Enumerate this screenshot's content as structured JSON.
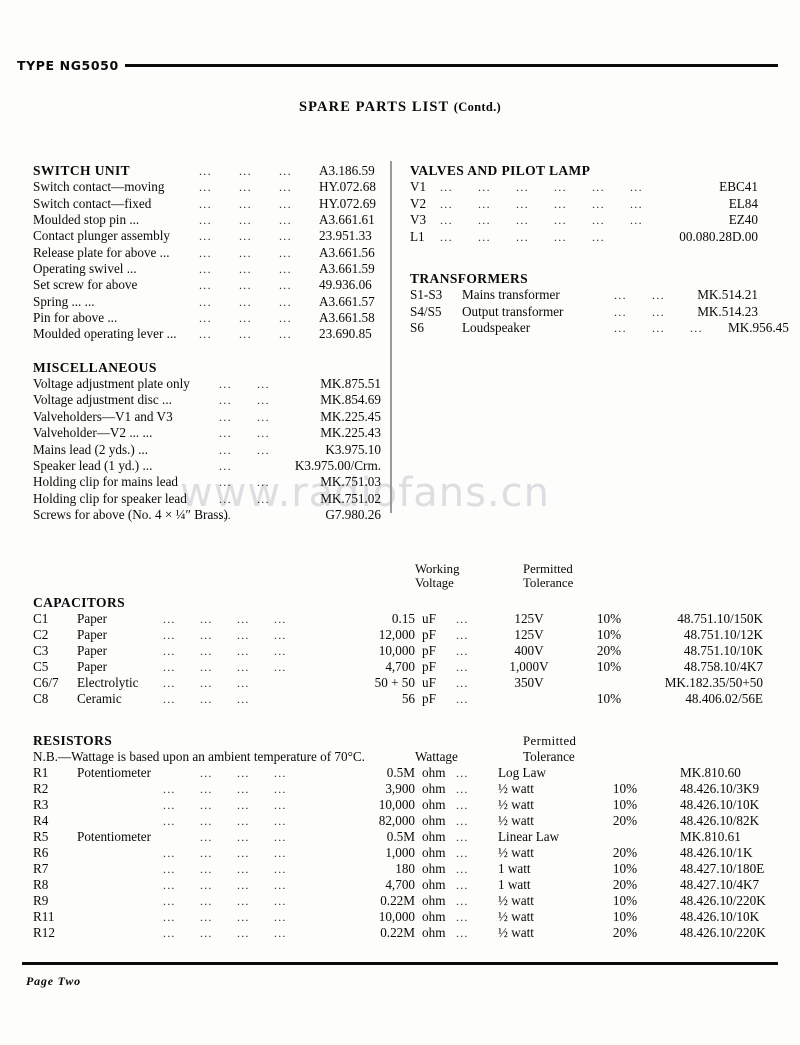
{
  "header": {
    "type_label": "TYPE  NG5050",
    "title": "SPARE PARTS LIST",
    "title_contd": "(Contd.)"
  },
  "watermark": "www.radiofans.cn",
  "footer": {
    "page_label": "Page Two"
  },
  "switch_unit": {
    "heading": "SWITCH UNIT",
    "heading_code": "A3.186.59",
    "rows": [
      {
        "label": "Switch contact—moving",
        "code": "HY.072.68"
      },
      {
        "label": "Switch contact—fixed",
        "code": "HY.072.69"
      },
      {
        "label": "Moulded stop pin ...",
        "code": "A3.661.61"
      },
      {
        "label": "Contact plunger assembly",
        "code": "23.951.33"
      },
      {
        "label": "Release plate for above ...",
        "code": "A3.661.56"
      },
      {
        "label": "Operating swivel   ...",
        "code": "A3.661.59"
      },
      {
        "label": "Set screw for above",
        "code": "49.936.06"
      },
      {
        "label": "Spring        ...        ...",
        "code": "A3.661.57"
      },
      {
        "label": "Pin for above      ...",
        "code": "A3.661.58"
      },
      {
        "label": "Moulded operating lever ...",
        "code": "23.690.85"
      }
    ]
  },
  "miscellaneous": {
    "heading": "MISCELLANEOUS",
    "rows": [
      {
        "label": "Voltage adjustment plate only",
        "dots": 2,
        "code": "MK.875.51"
      },
      {
        "label": "Voltage adjustment disc  ...",
        "dots": 2,
        "code": "MK.854.69"
      },
      {
        "label": "Valveholders—V1 and V3",
        "dots": 2,
        "code": "MK.225.45"
      },
      {
        "label": "Valveholder—V2   ...        ...",
        "dots": 2,
        "code": "MK.225.43"
      },
      {
        "label": "Mains lead (2 yds.)        ...",
        "dots": 2,
        "code": "K3.975.10"
      },
      {
        "label": "Speaker lead (1 yd.)     ...",
        "dots": 1,
        "code": "K3.975.00/Crm."
      },
      {
        "label": "Holding clip for mains lead",
        "dots": 2,
        "code": "MK.751.03"
      },
      {
        "label": "Holding clip for speaker lead",
        "dots": 2,
        "code": "MK.751.02"
      },
      {
        "label": "Screws for above (No. 4 × ¼″ Brass)",
        "dots": 1,
        "code": "G7.980.26"
      }
    ]
  },
  "valves": {
    "heading": "VALVES AND PILOT LAMP",
    "rows": [
      {
        "id": "V1",
        "dots": 6,
        "code": "EBC41"
      },
      {
        "id": "V2",
        "dots": 6,
        "code": "EL84"
      },
      {
        "id": "V3",
        "dots": 6,
        "code": "EZ40"
      },
      {
        "id": "L1",
        "dots": 5,
        "code": "00.080.28D.00"
      }
    ]
  },
  "transformers": {
    "heading": "TRANSFORMERS",
    "rows": [
      {
        "id": "S1-S3",
        "name": "Mains transformer",
        "dots": 2,
        "code": "MK.514.21"
      },
      {
        "id": "S4/S5",
        "name": "Output transformer",
        "dots": 2,
        "code": "MK.514.23"
      },
      {
        "id": "S6",
        "name": "Loudspeaker",
        "dots": 3,
        "code": "MK.956.45"
      }
    ]
  },
  "capacitors": {
    "heading": "CAPACITORS",
    "columns": {
      "working_voltage": [
        "Working",
        "Voltage"
      ],
      "permitted_tolerance": [
        "Permitted",
        "Tolerance"
      ]
    },
    "rows": [
      {
        "ref": "C1",
        "type": "Paper",
        "dots": 4,
        "value": "0.15",
        "unit": "uF",
        "voltage": "125V",
        "tolerance": "10%",
        "code": "48.751.10/150K"
      },
      {
        "ref": "C2",
        "type": "Paper",
        "dots": 4,
        "value": "12,000",
        "unit": "pF",
        "voltage": "125V",
        "tolerance": "10%",
        "code": "48.751.10/12K"
      },
      {
        "ref": "C3",
        "type": "Paper",
        "dots": 4,
        "value": "10,000",
        "unit": "pF",
        "voltage": "400V",
        "tolerance": "20%",
        "code": "48.751.10/10K"
      },
      {
        "ref": "C5",
        "type": "Paper",
        "dots": 4,
        "value": "4,700",
        "unit": "pF",
        "voltage": "1,000V",
        "tolerance": "10%",
        "code": "48.758.10/4K7"
      },
      {
        "ref": "C6/7",
        "type": "Electrolytic",
        "dots": 3,
        "value": "50 + 50",
        "unit": "uF",
        "voltage": "350V",
        "tolerance": "",
        "code": "MK.182.35/50+50"
      },
      {
        "ref": "C8",
        "type": "Ceramic",
        "dots": 3,
        "value": "56",
        "unit": "pF",
        "voltage": "",
        "tolerance": "10%",
        "code": "48.406.02/56E"
      }
    ]
  },
  "resistors": {
    "heading": "RESISTORS",
    "note": "N.B.—Wattage is based upon an ambient temperature of 70°C.",
    "columns": {
      "wattage": "Wattage",
      "permitted_tolerance": [
        "Permitted",
        "Tolerance"
      ]
    },
    "rows": [
      {
        "ref": "R1",
        "type": "Potentiometer",
        "dots": 3,
        "value": "0.5M",
        "unit": "ohm",
        "wattage": "Log Law",
        "tolerance": "",
        "code": "MK.810.60"
      },
      {
        "ref": "R2",
        "type": "",
        "dots": 4,
        "value": "3,900",
        "unit": "ohm",
        "wattage": "½ watt",
        "tolerance": "10%",
        "code": "48.426.10/3K9"
      },
      {
        "ref": "R3",
        "type": "",
        "dots": 4,
        "value": "10,000",
        "unit": "ohm",
        "wattage": "½ watt",
        "tolerance": "10%",
        "code": "48.426.10/10K"
      },
      {
        "ref": "R4",
        "type": "",
        "dots": 4,
        "value": "82,000",
        "unit": "ohm",
        "wattage": "½ watt",
        "tolerance": "20%",
        "code": "48.426.10/82K"
      },
      {
        "ref": "R5",
        "type": "Potentiometer",
        "dots": 3,
        "value": "0.5M",
        "unit": "ohm",
        "wattage": "Linear Law",
        "tolerance": "",
        "code": "MK.810.61"
      },
      {
        "ref": "R6",
        "type": "",
        "dots": 4,
        "value": "1,000",
        "unit": "ohm",
        "wattage": "½ watt",
        "tolerance": "20%",
        "code": "48.426.10/1K"
      },
      {
        "ref": "R7",
        "type": "",
        "dots": 4,
        "value": "180",
        "unit": "ohm",
        "wattage": "1 watt",
        "tolerance": "10%",
        "code": "48.427.10/180E"
      },
      {
        "ref": "R8",
        "type": "",
        "dots": 4,
        "value": "4,700",
        "unit": "ohm",
        "wattage": "1 watt",
        "tolerance": "20%",
        "code": "48.427.10/4K7"
      },
      {
        "ref": "R9",
        "type": "",
        "dots": 4,
        "value": "0.22M",
        "unit": "ohm",
        "wattage": "½ watt",
        "tolerance": "10%",
        "code": "48.426.10/220K"
      },
      {
        "ref": "R11",
        "type": "",
        "dots": 4,
        "value": "10,000",
        "unit": "ohm",
        "wattage": "½ watt",
        "tolerance": "10%",
        "code": "48.426.10/10K"
      },
      {
        "ref": "R12",
        "type": "",
        "dots": 4,
        "value": "0.22M",
        "unit": "ohm",
        "wattage": "½ watt",
        "tolerance": "20%",
        "code": "48.426.10/220K"
      }
    ]
  }
}
